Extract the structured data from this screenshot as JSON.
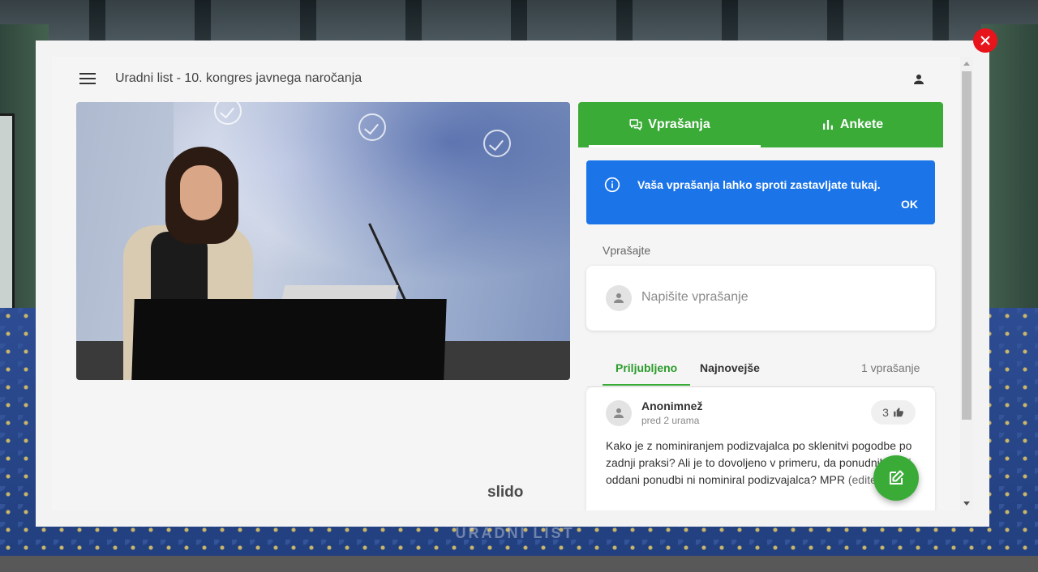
{
  "background": {
    "sign_text": "URADNI LIST"
  },
  "header": {
    "title": "Uradni list - 10. kongres javnega naročanja"
  },
  "tabs": [
    {
      "label": "Vprašanja",
      "icon": "chat-bubbles-icon",
      "active": true
    },
    {
      "label": "Ankete",
      "icon": "bar-chart-icon",
      "active": false
    }
  ],
  "banner": {
    "text": "Vaša vprašanja lahko sproti zastavljate tukaj.",
    "ok_label": "OK"
  },
  "ask": {
    "label": "Vprašajte",
    "placeholder": "Napišite vprašanje"
  },
  "sort": {
    "liked_label": "Priljubljeno",
    "newest_label": "Najnovejše",
    "count_text": "1 vprašanje"
  },
  "question": {
    "author": "Anonimnež",
    "time": "pred 2 urama",
    "likes": "3",
    "text": "Kako je z nominiranjem podizvajalca po sklenitvi pogodbe po zadnji praksi? Ali je to dovoljeno v primeru, da ponudnik svoji oddani ponudbi ni nominiral podizvajalca? MPR",
    "tag": "(edited)"
  },
  "branding": {
    "logo_text": "slido"
  },
  "colors": {
    "accent_green": "#3bab38",
    "banner_blue": "#1b74e8",
    "close_red": "#e8141b"
  }
}
